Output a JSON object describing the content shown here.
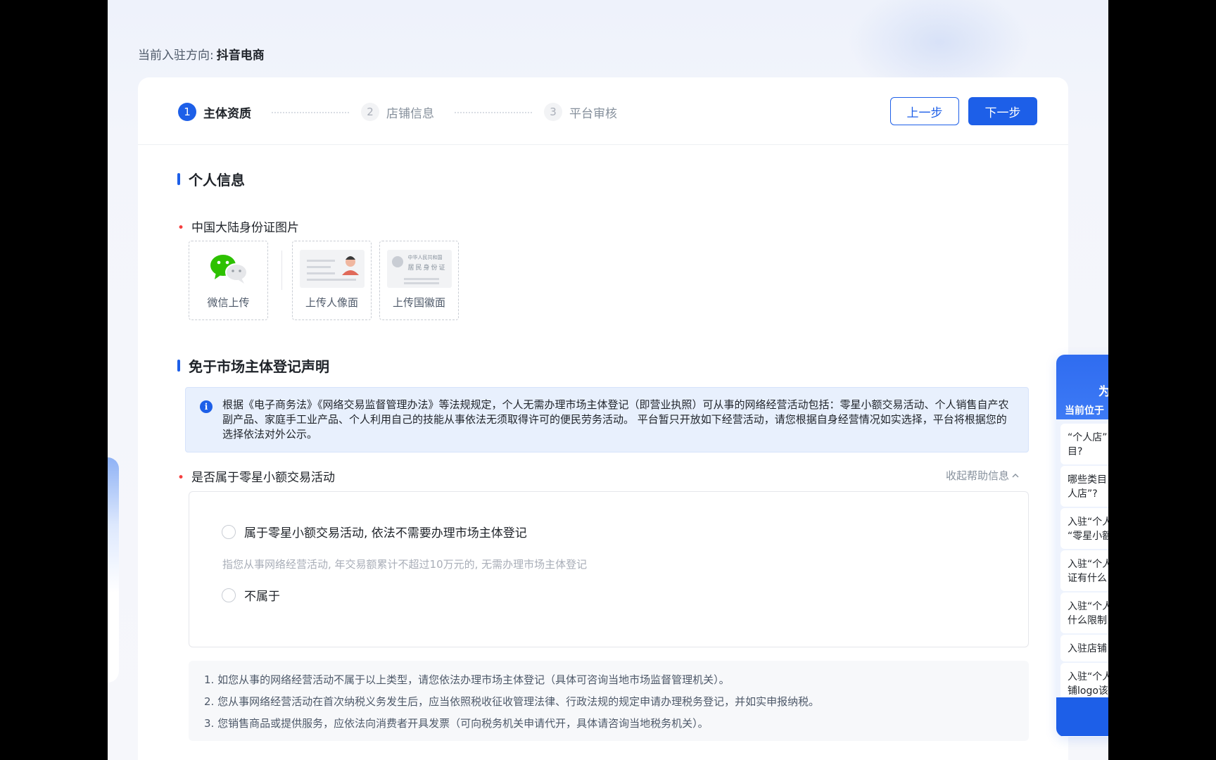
{
  "header": {
    "direction_label": "当前入驻方向:",
    "direction_value": "抖音电商"
  },
  "steps": [
    {
      "num": "1",
      "label": "主体资质",
      "state": "active"
    },
    {
      "num": "2",
      "label": "店铺信息",
      "state": "inactive"
    },
    {
      "num": "3",
      "label": "平台审核",
      "state": "inactive"
    }
  ],
  "buttons": {
    "prev": "上一步",
    "next": "下一步"
  },
  "personal": {
    "section_title": "个人信息",
    "id_label": "中国大陆身份证图片",
    "uploads": [
      {
        "label": "微信上传",
        "icon": "wechat-icon"
      },
      {
        "label": "上传人像面",
        "icon": "id-portrait-icon"
      },
      {
        "label": "上传国徽面",
        "icon": "id-emblem-icon"
      }
    ],
    "emblem_card_lines": [
      "中华人民共和国",
      "居民身份证"
    ]
  },
  "exempt": {
    "section_title": "免于市场主体登记声明",
    "notice_icon": "i",
    "notice_text": "根据《电子商务法》《网络交易监督管理办法》等法规规定，个人无需办理市场主体登记（即营业执照）可从事的网络经营活动包括：零星小额交易活动、个人销售自产农副产品、家庭手工业产品、个人利用自己的技能从事依法无须取得许可的便民劳务活动。 平台暂只开放如下经营活动，请您根据自身经营情况如实选择，平台将根据您的选择依法对外公示。",
    "question_label": "是否属于零星小额交易活动",
    "collapse_link": "收起帮助信息",
    "options": [
      {
        "label": "属于零星小额交易活动, 依法不需要办理市场主体登记",
        "desc": "指您从事网络经营活动, 年交易额累计不超过10万元的, 无需办理市场主体登记"
      },
      {
        "label": "不属于",
        "desc": ""
      }
    ],
    "notes": [
      "1. 如您从事的网络经营活动不属于以上类型，请您依法办理市场主体登记（具体可咨询当地市场监督管理机关）。",
      "2. 您从事网络经营活动在首次纳税义务发生后，应当依照税收征收管理法律、行政法规的规定申请办理税务登记，并如实申报纳税。",
      "3. 您销售商品或提供服务，应依法向消费者开具发票（可向税务机关申请代开，具体请咨询当地税务机关）。"
    ]
  },
  "help_panel": {
    "title": "为你",
    "subtitle": "当前位于",
    "items": [
      [
        "“个人店”",
        "目?"
      ],
      [
        "哪些类目",
        "人店”?"
      ],
      [
        "入驻“个人",
        "“零星小额"
      ],
      [
        "入驻“个人",
        "证有什么"
      ],
      [
        "入驻“个人",
        "什么限制"
      ],
      [
        "入驻店铺"
      ],
      [
        "入驻“个人",
        "铺logo该"
      ]
    ]
  },
  "colors": {
    "primary": "#1d5fe8",
    "required": "#f53f3f",
    "notice_bg": "#e8f0fd"
  }
}
